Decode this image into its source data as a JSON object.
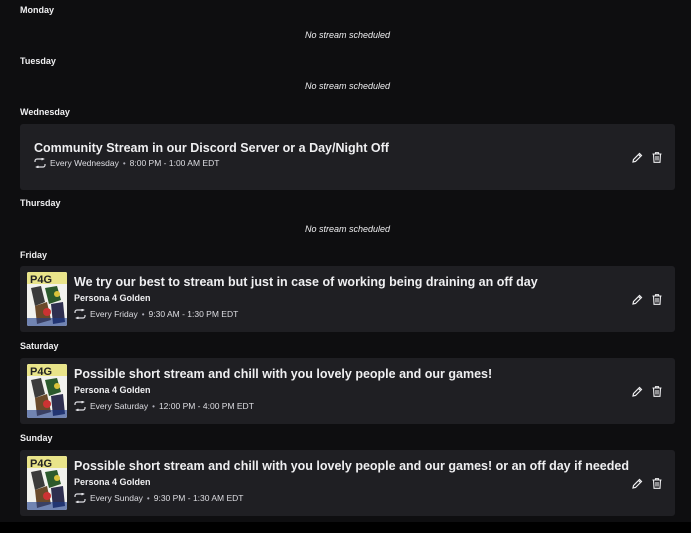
{
  "days": {
    "monday": {
      "label": "Monday",
      "empty": "No stream scheduled"
    },
    "tuesday": {
      "label": "Tuesday",
      "empty": "No stream scheduled"
    },
    "wednesday": {
      "label": "Wednesday",
      "title": "Community Stream in our Discord Server or a Day/Night Off",
      "repeat": "Every Wednesday",
      "time": "8:00 PM - 1:00 AM EDT"
    },
    "thursday": {
      "label": "Thursday",
      "empty": "No stream scheduled"
    },
    "friday": {
      "label": "Friday",
      "title": "We try our best to stream but just in case of working being draining an off day",
      "game": "Persona 4 Golden",
      "repeat": "Every Friday",
      "time": "9:30 AM - 1:30 PM EDT"
    },
    "saturday": {
      "label": "Saturday",
      "title": "Possible short stream and chill with you lovely people and our games!",
      "game": "Persona 4 Golden",
      "repeat": "Every Saturday",
      "time": "12:00 PM - 4:00 PM EDT"
    },
    "sunday": {
      "label": "Sunday",
      "title": "Possible short stream and chill with you lovely people and our games! or an off day if needed",
      "game": "Persona 4 Golden",
      "repeat": "Every Sunday",
      "time": "9:30 PM - 1:30 AM EDT"
    }
  },
  "icons": {
    "repeat": "repeat-icon",
    "edit": "pencil-icon",
    "delete": "trash-icon",
    "box_art": "persona-4-golden-box-art"
  },
  "colors": {
    "background": "#0e0e10",
    "card": "#1f1f23",
    "text": "#efeff1"
  }
}
